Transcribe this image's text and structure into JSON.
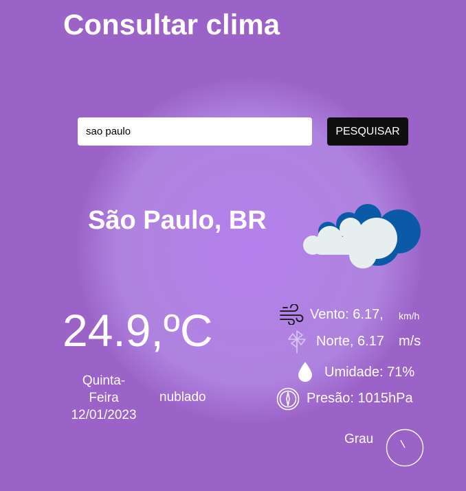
{
  "page": {
    "title": "Consultar clima"
  },
  "search": {
    "value": "sao paulo",
    "button_label": "PESQUISAR"
  },
  "location": {
    "city": "São Paulo, BR"
  },
  "current": {
    "temperature": "24.9,ºC",
    "day_line1": "Quinta-",
    "day_line2": "Feira",
    "date": "12/01/2023",
    "description": "nublado"
  },
  "details": {
    "wind_label": "Vento: 6.17,",
    "wind_unit": "km/h",
    "direction_label": "Norte, 6.17",
    "direction_unit": "m/s",
    "humidity": "Umidade: 71%",
    "pressure": "Presão: 1015hPa",
    "degree_label": "Grau"
  },
  "icons": {
    "weather": "cloud-icon",
    "wind": "wind-icon",
    "direction": "pinwheel-icon",
    "humidity": "droplet-icon",
    "pressure": "compass-icon",
    "degree": "dial-icon"
  },
  "colors": {
    "background": "#9b62c8",
    "glow": "#b580ec",
    "button": "#0f0f10",
    "cloud_back": "#0b5aa8",
    "cloud_front": "#e7efee"
  }
}
